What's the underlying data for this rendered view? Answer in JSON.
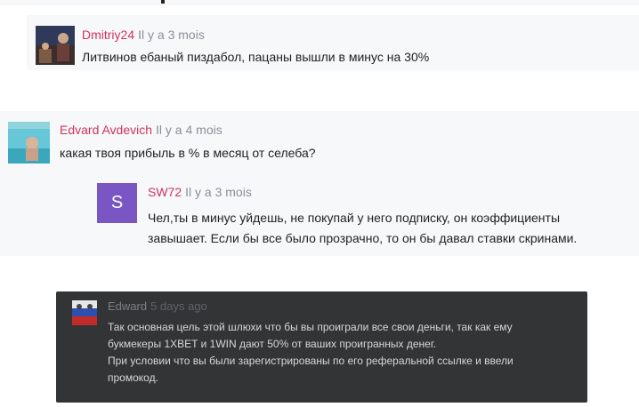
{
  "comments": [
    {
      "author": "Dmitriy24",
      "time": "Il y a 3 mois",
      "text": "Литвинов ебаный пиздабол, пацаны вышли в минус на 30%"
    },
    {
      "author": "Edvard Avdevich",
      "time": "Il y a 4 mois",
      "text": "какая твоя прибыль в % в месяц от селеба?"
    },
    {
      "author": "SW72",
      "time": "Il y a 3 mois",
      "avatar_letter": "S",
      "text_lines": [
        "Чел,ты в минус уйдешь, не покупай у него подписку, он коэффициенты",
        "завышает. Если бы все было прозрачно, то он бы давал ставки скринами."
      ]
    }
  ],
  "overlay_comment": {
    "author": "Edward",
    "time": "5 days ago",
    "text_lines": [
      "Так основная цель этой шлюхи что бы вы проиграли все свои деньги, так как ему",
      "букмекеры 1XBET и 1WIN дают 50% от ваших проигранных денег.",
      "При условии что вы были зарегистрированы по его реферальной ссылке и ввели",
      "промокод."
    ]
  },
  "colors": {
    "author_name": "#d0345a",
    "timestamp": "#8a8f96",
    "avatar_purple": "#7a56c4",
    "overlay_bg": "#333436"
  }
}
